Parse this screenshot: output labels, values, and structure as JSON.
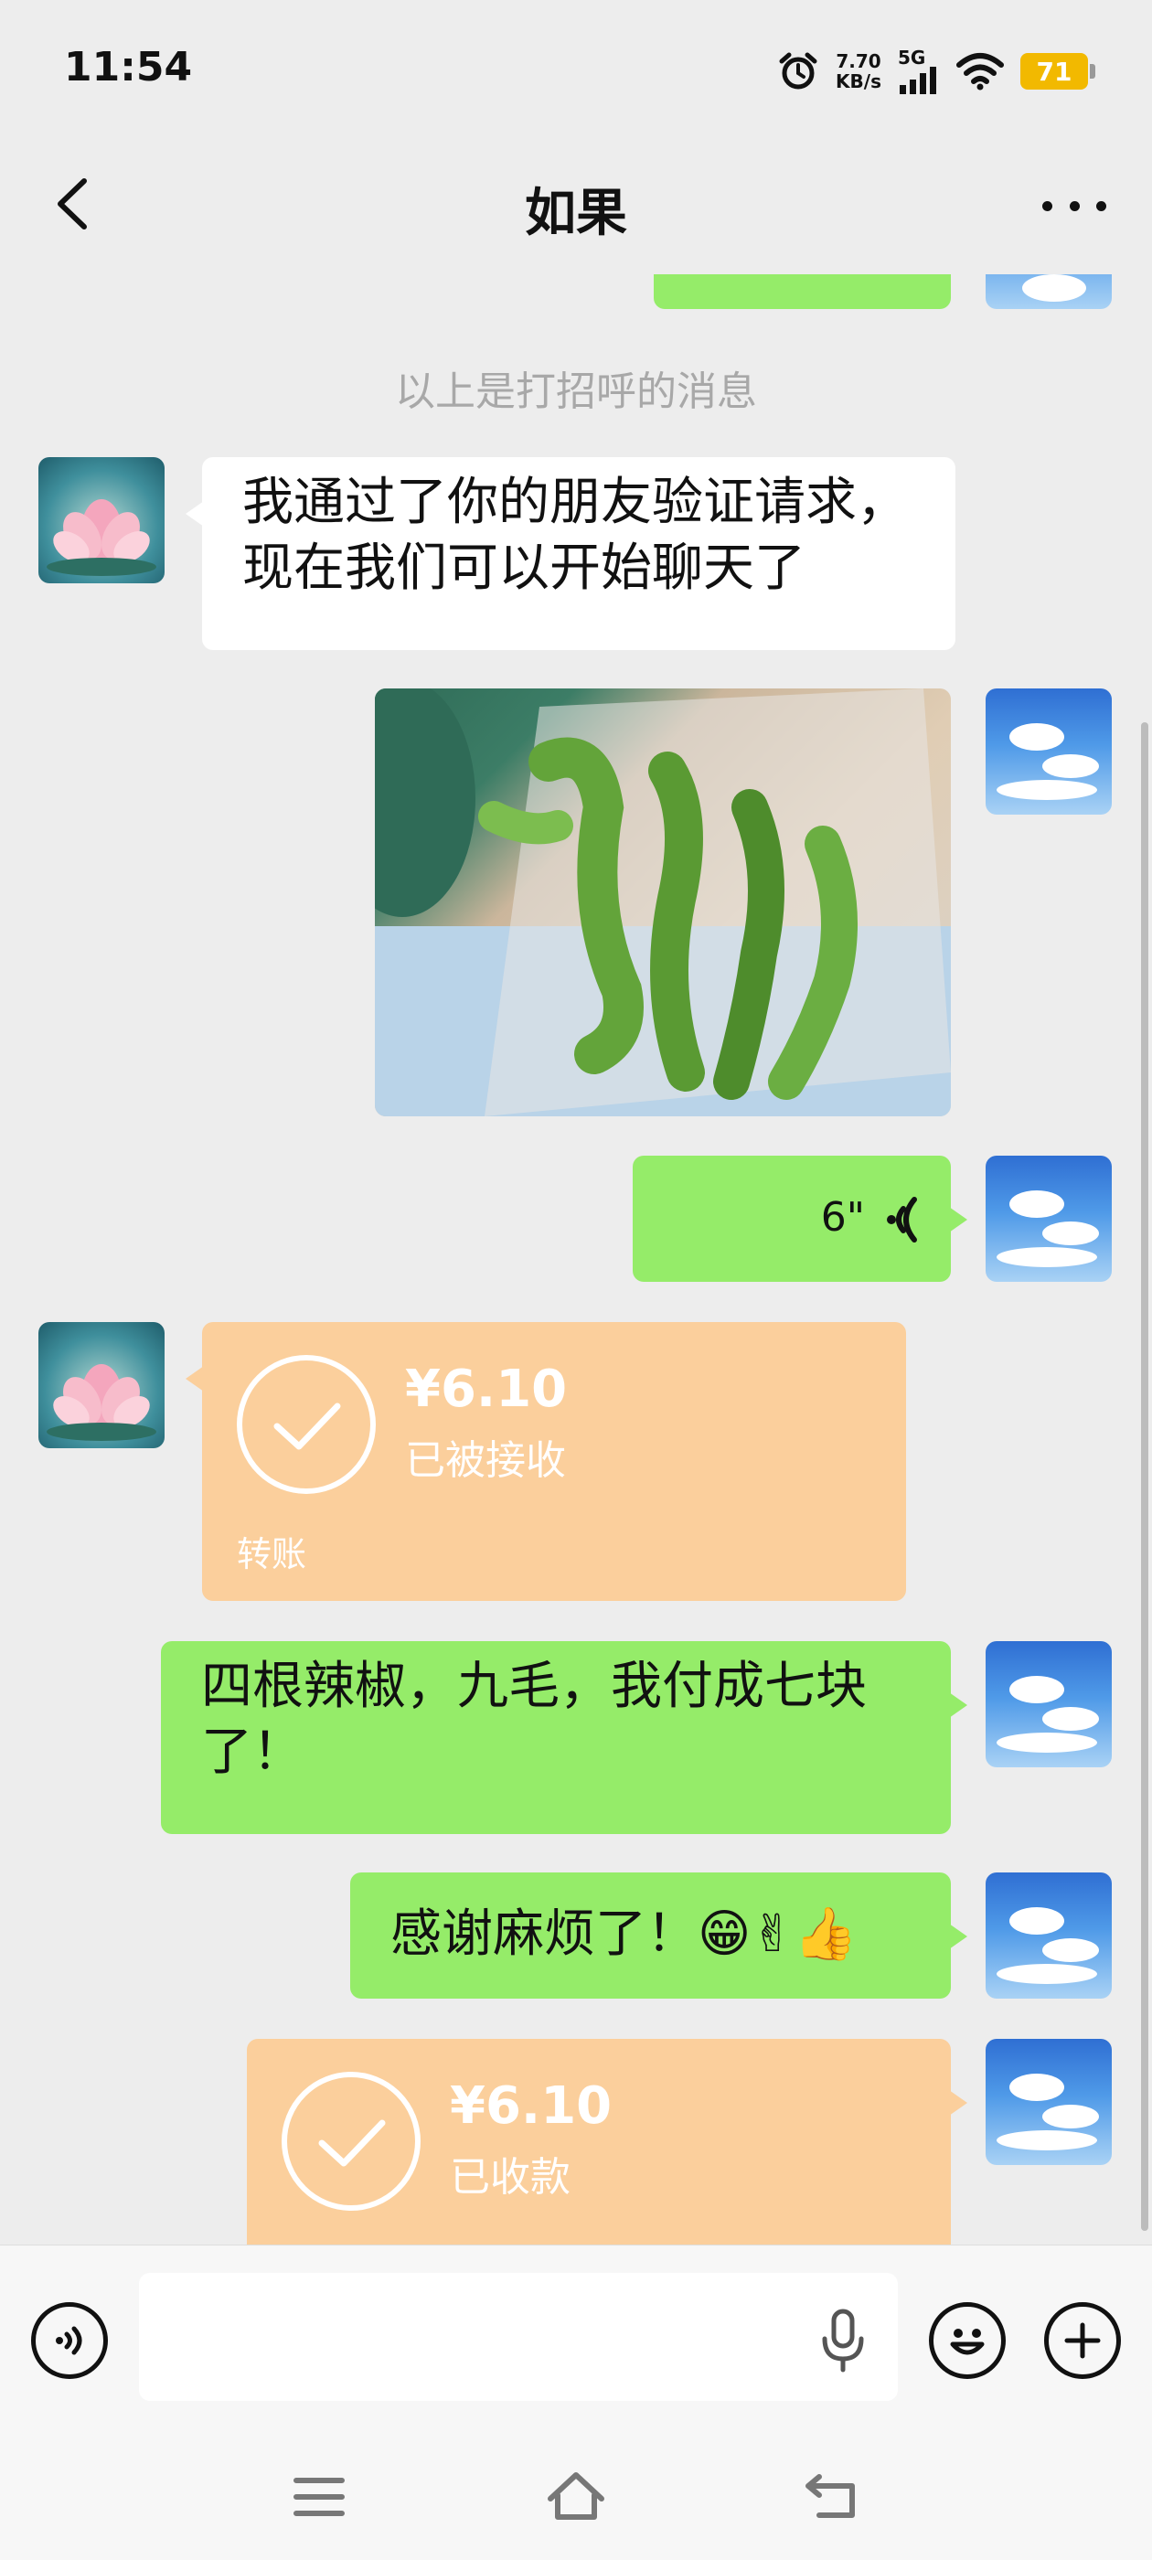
{
  "status_bar": {
    "time": "11:54",
    "net_speed_value": "7.70",
    "net_speed_unit": "KB/s",
    "network": "5G",
    "battery": "71",
    "battery_color": "#f2b900"
  },
  "header": {
    "title": "如果",
    "back_icon": "chevron-left-icon",
    "more_icon": "more-horizontal-icon"
  },
  "chat": {
    "system_note": "以上是打招呼的消息",
    "messages": [
      {
        "from": "other",
        "type": "text",
        "text_line1": "我通过了你的朋友验证请求，",
        "text_line2": "现在我们可以开始聊天了"
      },
      {
        "from": "me",
        "type": "image",
        "subject": "green peppers in plastic bag"
      },
      {
        "from": "me",
        "type": "voice",
        "duration": "6\""
      },
      {
        "from": "other",
        "type": "transfer",
        "amount": "¥6.10",
        "status": "已被接收",
        "label": "转账"
      },
      {
        "from": "me",
        "type": "text",
        "text_line1": "四根辣椒，九毛，我付成七块",
        "text_line2": "了！"
      },
      {
        "from": "me",
        "type": "text",
        "text": "感谢麻烦了！😁✌👍"
      },
      {
        "from": "me",
        "type": "transfer",
        "amount": "¥6.10",
        "status": "已收款"
      }
    ]
  },
  "input_bar": {
    "voice_icon": "voice-mode-icon",
    "mic_icon": "microphone-icon",
    "emoji_icon": "emoji-icon",
    "plus_icon": "plus-icon",
    "placeholder": ""
  },
  "colors": {
    "sent_bubble": "#95ec69",
    "transfer_bubble": "#fbcf9c",
    "background": "#ededed"
  }
}
